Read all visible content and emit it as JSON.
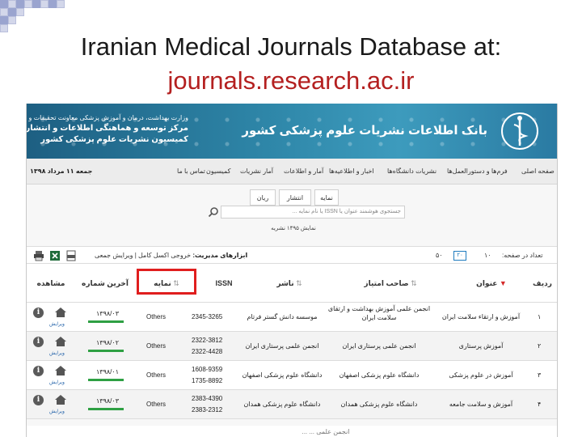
{
  "slide": {
    "title": "Iranian Medical Journals Database at:",
    "subtitle": "journals.research.ac.ir",
    "subtitle_color": "#b42020"
  },
  "banner": {
    "line1": "وزارت بهداشت، درمان و آموزش پزشکی معاونت تحقیقات و فناوری",
    "line2": "مرکز توسعه و هماهنگی اطلاعات و انتشارات علمی",
    "line3": "کمیسیون نشریات علوم پزشکی کشور",
    "logo_text": "بانک اطلاعات نشریات علوم پزشکی کشور",
    "logo_icon": "medical-emblem-icon"
  },
  "nav": {
    "items": [
      "صفحه اصلی",
      "فرم‌ها و دستورالعمل‌ها",
      "نشریات دانشگاه‌ها",
      "اخبار و اطلاعیه‌ها",
      "آمار و اطلاعات",
      "آمار نشریات",
      "کمیسیون",
      "تماس با ما"
    ],
    "date": "جمعه ۱۱ مرداد ۱۳۹۸"
  },
  "search": {
    "tabs": [
      "نمایه",
      "انتشار",
      "ریان"
    ],
    "placeholder": "جستجوی هوشمند عنوان یا ISSN یا نام نمایه ...",
    "count": "نمایش ۱۴۹۵ نشریه"
  },
  "toolbar": {
    "tools_label": "ابزارهای مدیریت:",
    "tools_links": "خروجی اکسل کامل | ویرایش جمعی",
    "per_page": "تعداد در صفحه:",
    "options": [
      "۱۰",
      "۲۰",
      "۵۰"
    ],
    "selected": "۲۰",
    "icons": [
      "print-icon",
      "excel-icon",
      "pdf-icon"
    ]
  },
  "table": {
    "headers": {
      "row": "ردیف",
      "title": "عنوان",
      "license": "صاحب امتیاز",
      "publisher": "ناشر",
      "issn": "ISSN",
      "index": "نمایه",
      "last_issue": "آخرین شماره",
      "view": "مشاهده"
    },
    "highlight_color": "#e01e1e",
    "edit_label": "ویرایش",
    "rows": [
      {
        "num": "۱",
        "title": "آموزش و ارتقاء سلامت ایران",
        "license": "انجمن علمی آموزش بهداشت و ارتقای سلامت ایران",
        "publisher": "موسسه دانش گستر فرتام",
        "issn": "2345-3265",
        "index": "Others",
        "last": "۱۳۹۸/۰۳"
      },
      {
        "num": "۲",
        "title": "آموزش پرستاری",
        "license": "انجمن علمی پرستاری ایران",
        "publisher": "انجمن علمی پرستاری ایران",
        "issn": "2322-3812",
        "issn2": "2322-4428",
        "index": "Others",
        "last": "۱۳۹۸/۰۲"
      },
      {
        "num": "۳",
        "title": "آموزش در علوم پزشکی",
        "license": "دانشگاه علوم پزشکی اصفهان",
        "publisher": "دانشگاه علوم پزشکی اصفهان",
        "issn": "1608-9359",
        "issn2": "1735-8892",
        "index": "Others",
        "last": "۱۳۹۸/۰۱"
      },
      {
        "num": "۴",
        "title": "آموزش و سلامت جامعه",
        "license": "دانشگاه علوم پزشکی همدان",
        "publisher": "دانشگاه علوم پزشکی همدان",
        "issn": "2383-4390",
        "issn2": "2383-2312",
        "index": "Others",
        "last": "۱۳۹۸/۰۳"
      }
    ],
    "partial_row": "انجمن علمی ... ..."
  }
}
